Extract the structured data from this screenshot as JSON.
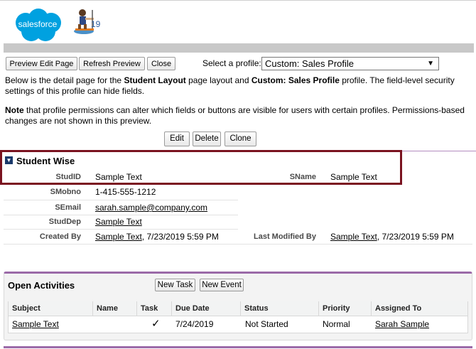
{
  "app": {
    "logo_text": "salesforce",
    "release_badge": "19"
  },
  "toolbar": {
    "preview_edit_label": "Preview Edit Page",
    "refresh_label": "Refresh Preview",
    "close_label": "Close",
    "profile_label": "Select a profile:",
    "profile_value": "Custom: Sales Profile"
  },
  "intro": {
    "line1_a": "Below is the detail page for the ",
    "layout_name": "Student Layout",
    "line1_b": " page layout and ",
    "profile_name": "Custom: Sales Profile",
    "line1_c": " profile. The field-level security settings of this profile can hide fields.",
    "note_bold": "Note",
    "note_text": " that profile permissions can alter which fields or buttons are visible for users with certain profiles. Permissions-based changes are not shown in this preview."
  },
  "record_buttons": {
    "edit": "Edit",
    "delete": "Delete",
    "clone": "Clone"
  },
  "section": {
    "title": "Student Wise",
    "fields": {
      "studid_label": "StudID",
      "studid_value": "Sample Text",
      "sname_label": "SName",
      "sname_value": "Sample Text",
      "smobno_label": "SMobno",
      "smobno_value": "1-415-555-1212",
      "semail_label": "SEmail",
      "semail_value": "sarah.sample@company.com",
      "studdep_label": "StudDep",
      "studdep_value": "Sample Text",
      "created_label": "Created By",
      "created_user": "Sample Text",
      "created_date": ", 7/23/2019 5:59 PM",
      "modified_label": "Last Modified By",
      "modified_user": "Sample Text",
      "modified_date": ", 7/23/2019 5:59 PM"
    }
  },
  "open_activities": {
    "title": "Open Activities",
    "new_task": "New Task",
    "new_event": "New Event",
    "columns": [
      "Subject",
      "Name",
      "Task",
      "Due Date",
      "Status",
      "Priority",
      "Assigned To"
    ],
    "row": {
      "subject": "Sample Text",
      "name": "",
      "task": "✓",
      "due_date": "7/24/2019",
      "status": "Not Started",
      "priority": "Normal",
      "assigned_to": "Sarah Sample"
    }
  },
  "colors": {
    "brand_blue": "#00a1e0",
    "highlight_box": "#7a1320",
    "section_accent": "#9b6aa8"
  }
}
